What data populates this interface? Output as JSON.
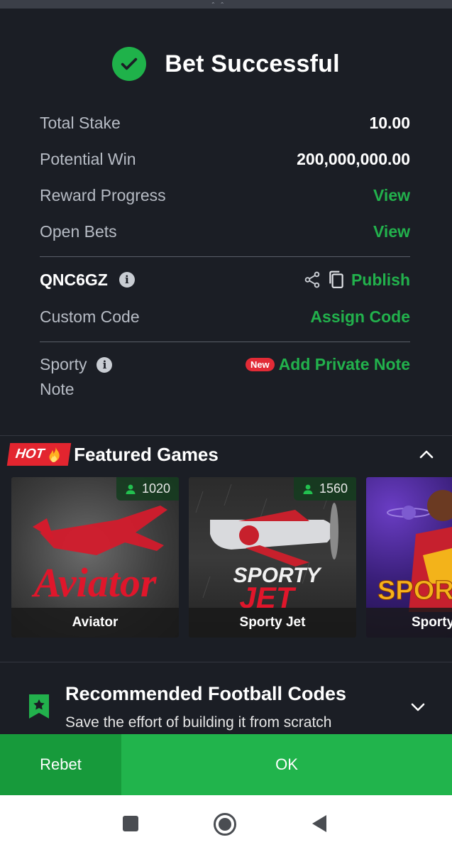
{
  "header": {
    "title": "Bet Successful"
  },
  "summary": [
    {
      "label": "Total Stake",
      "value": "10.00"
    },
    {
      "label": "Potential Win",
      "value": "200,000,000.00"
    },
    {
      "label": "Reward Progress",
      "value": "View"
    },
    {
      "label": "Open Bets",
      "value": "View"
    }
  ],
  "booking": {
    "code": "QNC6GZ",
    "publish_label": "Publish"
  },
  "custom_code": {
    "label": "Custom Code",
    "action": "Assign Code"
  },
  "note": {
    "label_line1": "Sporty",
    "label_line2": "Note",
    "badge": "New",
    "action": "Add Private Note"
  },
  "featured": {
    "hot_label": "HOT",
    "title": "Featured Games",
    "games": [
      {
        "name": "Aviator",
        "players": "1020",
        "art_text": "Aviator"
      },
      {
        "name": "Sporty Jet",
        "players": "1560",
        "art_text_line1": "SPORTY",
        "art_text_line2": "JET"
      },
      {
        "name": "Sporty",
        "players": "",
        "art_text": "SPORT"
      }
    ]
  },
  "recommended": {
    "title": "Recommended Football Codes",
    "subtitle": "Save the effort of building it from scratch"
  },
  "actions": {
    "rebet_label": "Rebet",
    "ok_label": "OK"
  },
  "colors": {
    "accent": "#22b14c",
    "background": "#1b1e25",
    "hot": "#e3252f"
  }
}
